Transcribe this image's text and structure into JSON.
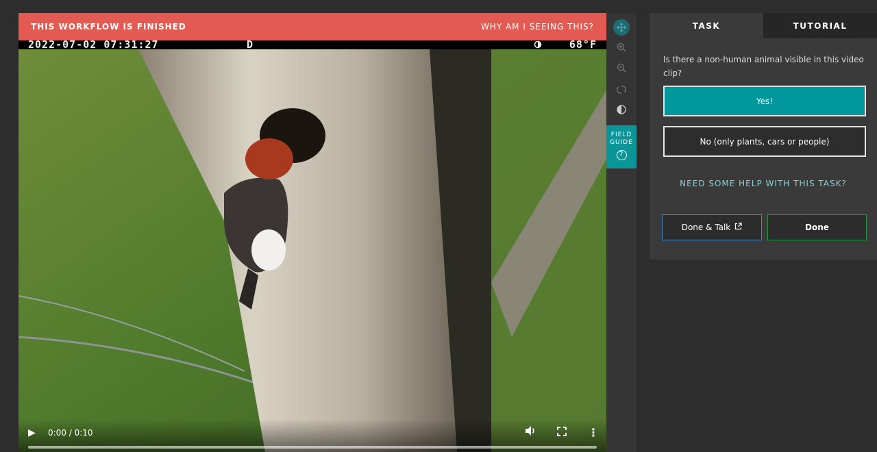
{
  "banner": {
    "title": "THIS WORKFLOW IS FINISHED",
    "why": "WHY AM I SEEING THIS?"
  },
  "osd": {
    "timestamp": "2022-07-02 07:31:27",
    "flag": "D",
    "temperature": "68°F"
  },
  "video": {
    "time": "0:00 / 0:10",
    "progress": 0
  },
  "toolbar": {
    "tools": [
      "move-icon",
      "zoom-in-icon",
      "zoom-out-icon",
      "rotate-icon",
      "invert-icon"
    ],
    "field_guide": [
      "FIELD",
      "GUIDE"
    ],
    "field_guide_glyph": "?"
  },
  "panel": {
    "tabs": [
      {
        "label": "TASK",
        "active": true
      },
      {
        "label": "TUTORIAL",
        "active": false
      }
    ],
    "question": "Is there a non-human animal visible in this video clip?",
    "answers": [
      "Yes!",
      "No (only plants, cars or people)"
    ],
    "help": "NEED SOME HELP WITH THIS TASK?",
    "buttons": {
      "done_talk": "Done & Talk",
      "done": "Done"
    }
  },
  "colors": {
    "banner": "#e35a52",
    "accent": "#00979d",
    "help": "#8ad1d1",
    "talk_border": "#3e87c9",
    "done_border": "#1e9b3c"
  }
}
